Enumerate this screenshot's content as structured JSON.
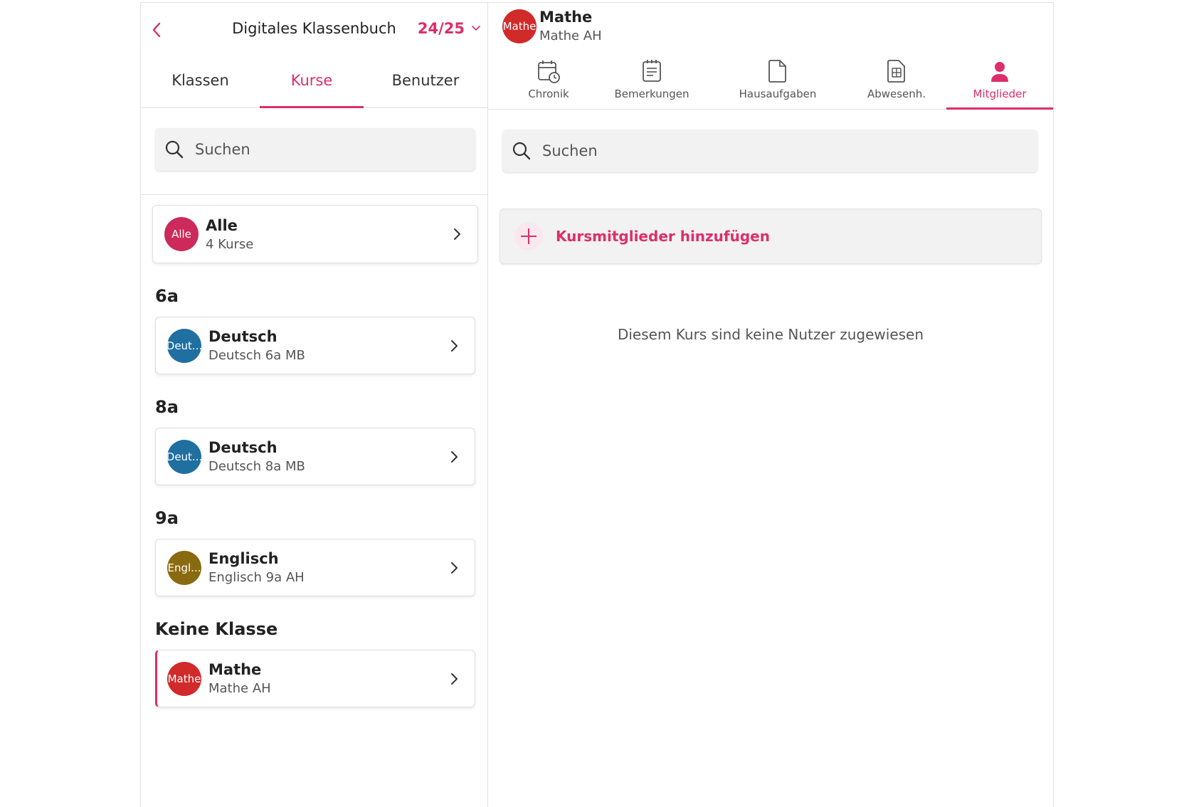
{
  "left": {
    "title": "Digitales Klassenbuch",
    "year": "24/25",
    "tabs": [
      {
        "label": "Klassen"
      },
      {
        "label": "Kurse"
      },
      {
        "label": "Benutzer"
      }
    ],
    "search_placeholder": "Suchen",
    "all_card": {
      "avatar": "Alle",
      "title": "Alle",
      "subtitle": "4 Kurse",
      "color": "#cc2a5a"
    },
    "sections": [
      {
        "heading": "6a",
        "course": {
          "avatar": "Deut...",
          "title": "Deutsch",
          "subtitle": "Deutsch 6a MB",
          "color": "#1f6fa0"
        }
      },
      {
        "heading": "8a",
        "course": {
          "avatar": "Deut...",
          "title": "Deutsch",
          "subtitle": "Deutsch 8a MB",
          "color": "#1f6fa0"
        }
      },
      {
        "heading": "9a",
        "course": {
          "avatar": "Engl...",
          "title": "Englisch",
          "subtitle": "Englisch 9a AH",
          "color": "#8a6a10"
        }
      },
      {
        "heading": "Keine Klasse",
        "course": {
          "avatar": "Mathe",
          "title": "Mathe",
          "subtitle": "Mathe AH",
          "color": "#d12a2a"
        }
      }
    ]
  },
  "right": {
    "course": {
      "avatar": "Mathe",
      "title": "Mathe",
      "subtitle": "Mathe AH",
      "color": "#d12a2a"
    },
    "tabs": [
      {
        "label": "Chronik",
        "icon": "calendar-clock-icon"
      },
      {
        "label": "Bemerkungen",
        "icon": "notes-icon"
      },
      {
        "label": "Hausaufgaben",
        "icon": "document-icon"
      },
      {
        "label": "Abwesenh.",
        "icon": "table-document-icon"
      },
      {
        "label": "Mitglieder",
        "icon": "person-icon"
      }
    ],
    "search_placeholder": "Suchen",
    "add_label": "Kursmitglieder hinzufügen",
    "empty_message": "Diesem Kurs sind keine Nutzer zugewiesen"
  },
  "colors": {
    "accent": "#dd2e6a"
  }
}
